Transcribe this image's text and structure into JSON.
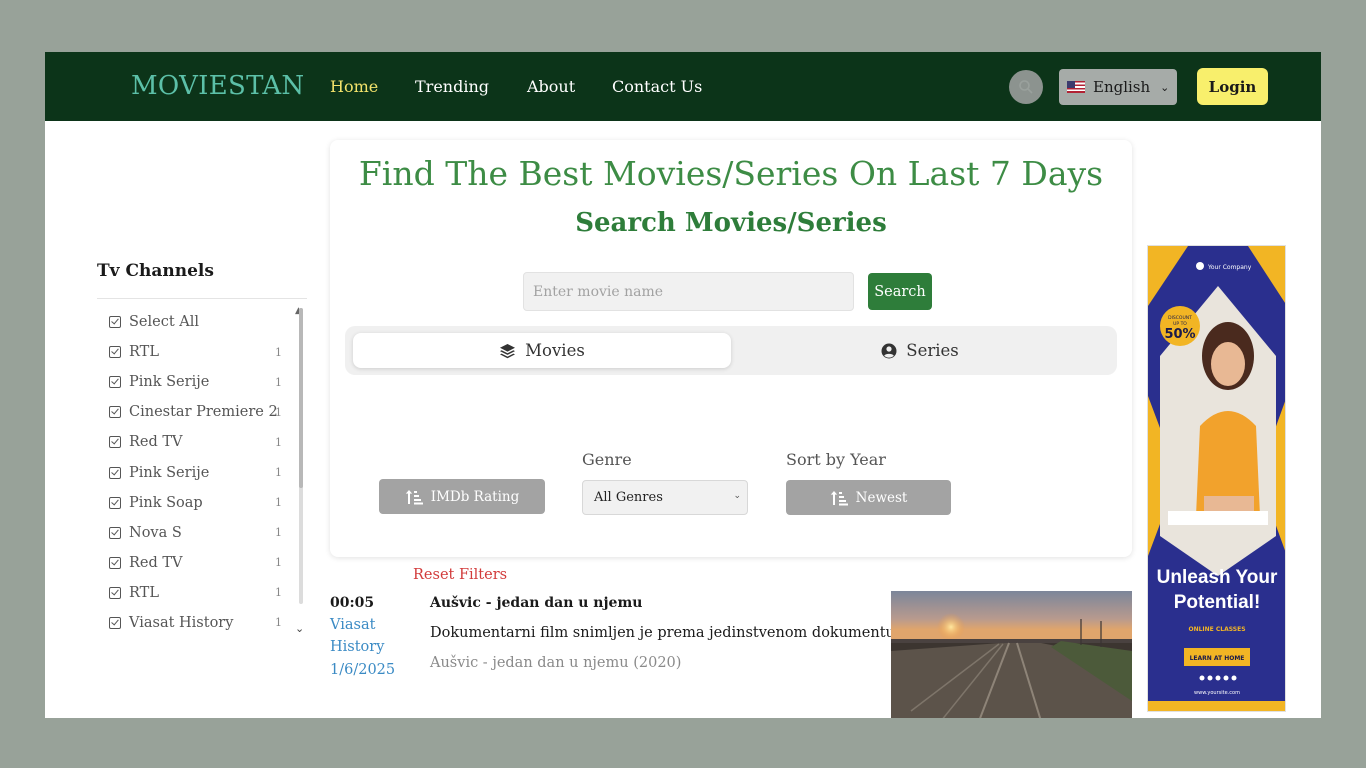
{
  "header": {
    "logo": "MOVIESTAN",
    "nav": [
      {
        "label": "Home",
        "active": true
      },
      {
        "label": "Trending",
        "active": false
      },
      {
        "label": "About",
        "active": false
      },
      {
        "label": "Contact Us",
        "active": false
      }
    ],
    "search_icon": "search-icon",
    "language": {
      "label": "English",
      "flag": "us-flag-icon"
    },
    "login_label": "Login"
  },
  "sidebar": {
    "title": "Tv Channels",
    "channels": [
      {
        "name": "Select All",
        "count": ""
      },
      {
        "name": "RTL",
        "count": "1"
      },
      {
        "name": "Pink Serije",
        "count": "1"
      },
      {
        "name": "Cinestar Premiere 2",
        "count": "1"
      },
      {
        "name": "Red TV",
        "count": "1"
      },
      {
        "name": "Pink Serije",
        "count": "1"
      },
      {
        "name": "Pink Soap",
        "count": "1"
      },
      {
        "name": "Nova S",
        "count": "1"
      },
      {
        "name": "Red TV",
        "count": "1"
      },
      {
        "name": "RTL",
        "count": "1"
      },
      {
        "name": "Viasat History",
        "count": "1"
      }
    ]
  },
  "main": {
    "title": "Find The Best Movies/Series On Last 7 Days",
    "subtitle": "Search Movies/Series",
    "search_placeholder": "Enter movie name",
    "search_button": "Search",
    "tabs": [
      {
        "label": "Movies",
        "icon": "layers-icon",
        "active": true
      },
      {
        "label": "Series",
        "icon": "user-circle-icon",
        "active": false
      }
    ],
    "filters": {
      "imdb_button": "IMDb Rating",
      "genre_label": "Genre",
      "genre_value": "All Genres",
      "sort_label": "Sort by Year",
      "sort_button": "Newest",
      "reset": "Reset Filters"
    }
  },
  "listing": {
    "time": "00:05",
    "channel_line1": "Viasat",
    "channel_line2": "History",
    "date": "1/6/2025",
    "title": "Aušvic - jedan dan u njemu",
    "description": "Dokumentarni film snimljen je prema jedinstvenom dokumentu",
    "original": "Aušvic - jedan dan u njemu (2020)"
  },
  "ad": {
    "company": "Your Company",
    "discount_line1": "DISCOUNT",
    "discount_line2": "UP TO",
    "discount_value": "50%",
    "headline_line1": "Unleash Your",
    "headline_line2": "Potential!",
    "tagline": "ONLINE CLASSES",
    "cta": "LEARN AT HOME",
    "site": "www.yoursite.com"
  },
  "colors": {
    "header_bg": "#0c3419",
    "logo": "#5cc0a8",
    "nav_active": "#f3e36b",
    "login_bg": "#f8ef6c",
    "green_title": "#3d8c45",
    "search_btn": "#2e7d3a",
    "reset": "#d23b3b",
    "link_blue": "#3a8ac4"
  }
}
